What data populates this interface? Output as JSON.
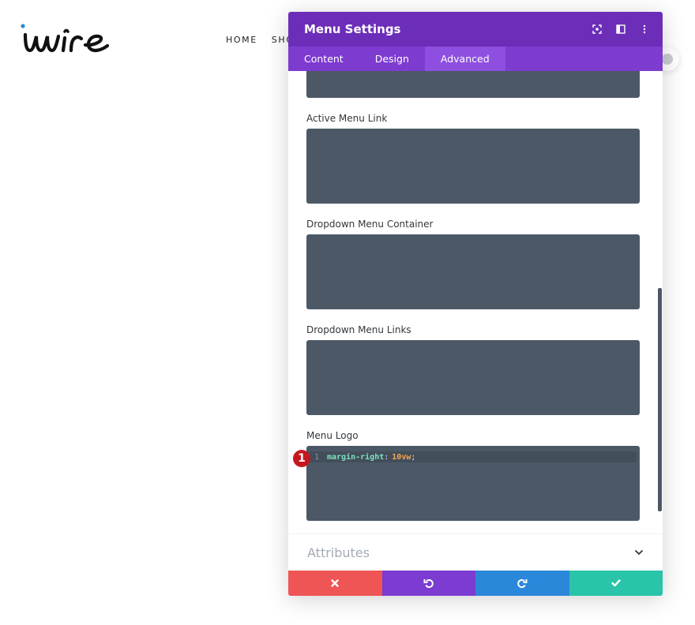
{
  "site": {
    "logo_text": "wire",
    "nav": [
      "HOME",
      "SHO"
    ]
  },
  "modal": {
    "title": "Menu Settings",
    "header_icons": [
      "focus-icon",
      "split-view-icon",
      "more-options-icon"
    ],
    "tabs": [
      {
        "label": "Content",
        "active": false
      },
      {
        "label": "Design",
        "active": false
      },
      {
        "label": "Advanced",
        "active": true
      }
    ],
    "fields": [
      {
        "label": "Active Menu Link"
      },
      {
        "label": "Dropdown Menu Container"
      },
      {
        "label": "Dropdown Menu Links"
      },
      {
        "label": "Menu Logo"
      }
    ],
    "code": {
      "line_number": "1",
      "property": "margin-right",
      "colon": ":",
      "value": "10vw",
      "semicolon": ";"
    },
    "badge": "1",
    "attributes_label": "Attributes",
    "footer_icons": [
      "close-icon",
      "undo-icon",
      "redo-icon",
      "check-icon"
    ]
  },
  "colors": {
    "header": "#6c2eb9",
    "tabs": "#7d3bd0",
    "tab_active": "#8e4fe0",
    "code_bg": "#4c5866",
    "cancel": "#ef5555",
    "undo": "#7c3bd1",
    "redo": "#2b87da",
    "save": "#29c4a9",
    "badge": "#c5171f"
  }
}
